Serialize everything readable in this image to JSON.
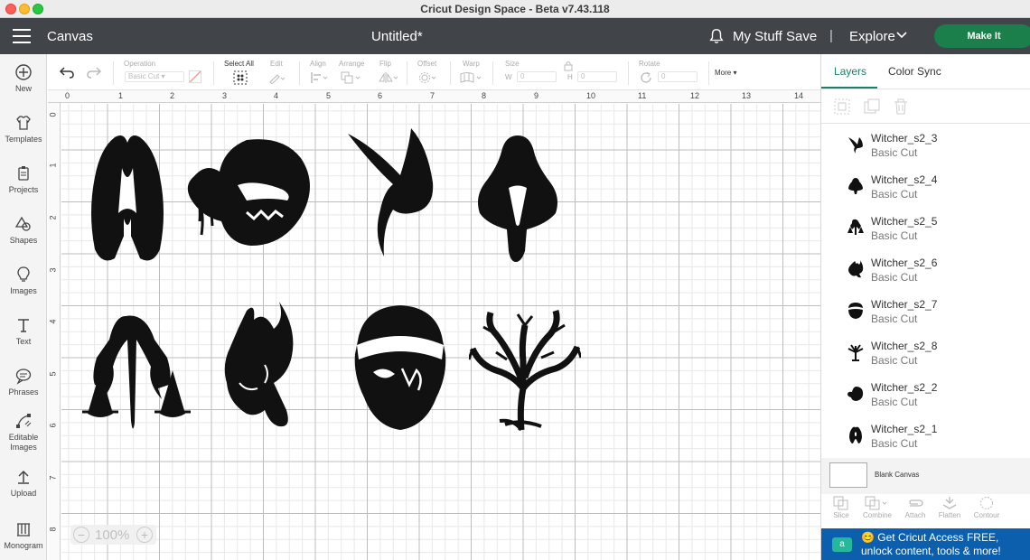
{
  "window": {
    "title": "Cricut Design Space - Beta v7.43.118"
  },
  "header": {
    "canvas_label": "Canvas",
    "doc_title": "Untitled*",
    "my_stuff": "My Stuff",
    "save": "Save",
    "separator": "|",
    "explore": "Explore",
    "make_it": "Make It"
  },
  "sidebar": {
    "items": [
      {
        "label": "New",
        "icon": "plus-circle-icon"
      },
      {
        "label": "Templates",
        "icon": "shirt-icon"
      },
      {
        "label": "Projects",
        "icon": "clipboard-icon"
      },
      {
        "label": "Shapes",
        "icon": "shapes-icon"
      },
      {
        "label": "Images",
        "icon": "lightbulb-icon"
      },
      {
        "label": "Text",
        "icon": "text-t-icon"
      },
      {
        "label": "Phrases",
        "icon": "speech-bubble-icon"
      },
      {
        "label": "Editable Images",
        "icon": "edit-nodes-icon"
      },
      {
        "label": "Upload",
        "icon": "upload-icon"
      },
      {
        "label": "Monogram",
        "icon": "monogram-icon"
      }
    ]
  },
  "toolbar": {
    "operation_label": "Operation",
    "operation_value": "Basic Cut",
    "select_all": "Select All",
    "edit": "Edit",
    "align": "Align",
    "arrange": "Arrange",
    "flip": "Flip",
    "offset": "Offset",
    "warp": "Warp",
    "size": "Size",
    "size_w_label": "W",
    "size_w_value": "0",
    "size_h_label": "H",
    "size_h_value": "0",
    "rotate": "Rotate",
    "rotate_value": "0",
    "more": "More"
  },
  "canvas": {
    "ruler_top": [
      "0",
      "1",
      "2",
      "3",
      "4",
      "5",
      "6",
      "7",
      "8",
      "9",
      "10",
      "11",
      "12",
      "13",
      "14"
    ],
    "ruler_left": [
      "0",
      "1",
      "2",
      "3",
      "4",
      "5",
      "6",
      "7",
      "8"
    ],
    "zoom": "100%"
  },
  "right_panel": {
    "tabs": {
      "layers": "Layers",
      "color_sync": "Color Sync"
    },
    "layers": [
      {
        "name": "Witcher_s2_3",
        "type": "Basic Cut"
      },
      {
        "name": "Witcher_s2_4",
        "type": "Basic Cut"
      },
      {
        "name": "Witcher_s2_5",
        "type": "Basic Cut"
      },
      {
        "name": "Witcher_s2_6",
        "type": "Basic Cut"
      },
      {
        "name": "Witcher_s2_7",
        "type": "Basic Cut"
      },
      {
        "name": "Witcher_s2_8",
        "type": "Basic Cut"
      },
      {
        "name": "Witcher_s2_2",
        "type": "Basic Cut"
      },
      {
        "name": "Witcher_s2_1",
        "type": "Basic Cut"
      }
    ],
    "blank_canvas": "Blank Canvas",
    "bottom_tools": [
      "Slice",
      "Combine",
      "Attach",
      "Flatten",
      "Contour"
    ],
    "promo_logo": "a",
    "promo_text": "😊 Get Cricut Access FREE, unlock content, tools & more!"
  }
}
